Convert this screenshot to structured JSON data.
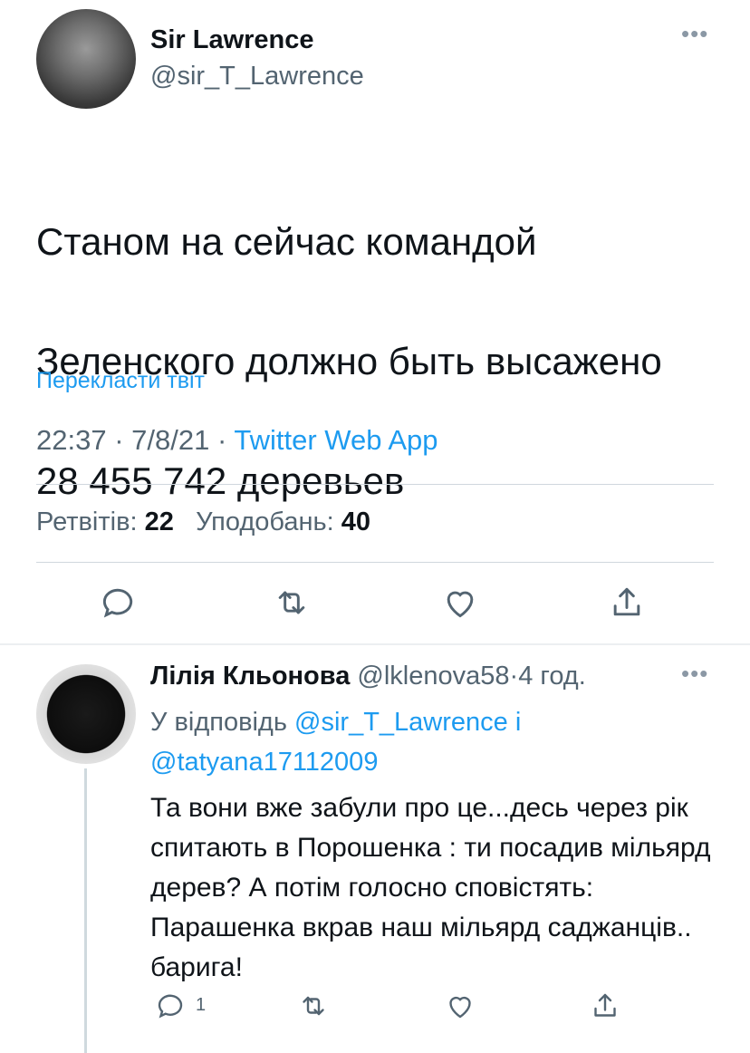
{
  "tweet": {
    "author_name": "Sir Lawrence",
    "author_handle": "@sir_T_Lawrence",
    "text_lines": [
      "Станом на сейчас командой",
      "Зеленского должно быть высажено",
      "28 455 742 деревьев"
    ],
    "translate_label": "Перекласти твіт",
    "time": "22:37",
    "date": "7/8/21",
    "source": "Twitter Web App",
    "separator": "·",
    "retweets_label": "Ретвітів:",
    "retweets_count": "22",
    "likes_label": "Уподобань:",
    "likes_count": "40",
    "more_label": "•••",
    "actions": [
      "reply-icon",
      "retweet-icon",
      "like-icon",
      "share-icon"
    ]
  },
  "reply": {
    "author_name": "Лілія Кльонова",
    "author_handle": "@lklenova58",
    "time": "4 год.",
    "separator": "·",
    "reply_prefix": "У відповідь",
    "mention_1": "@sir_T_Lawrence",
    "conjunction": "і",
    "mention_2": "@tatyana17112009",
    "text": "Та вони вже забули про це...десь через рік спитають в Порошенка : ти посадив мільярд дерев? А потім голосно сповістять: Парашенка вкрав наш мільярд саджанців.. барига!",
    "reply_count": "1",
    "more_label": "•••",
    "actions": [
      "reply-icon",
      "retweet-icon",
      "like-icon",
      "share-icon"
    ]
  },
  "colors": {
    "accent": "#1d9bf0",
    "secondary_text": "#536471",
    "primary_text": "#0f1419"
  }
}
